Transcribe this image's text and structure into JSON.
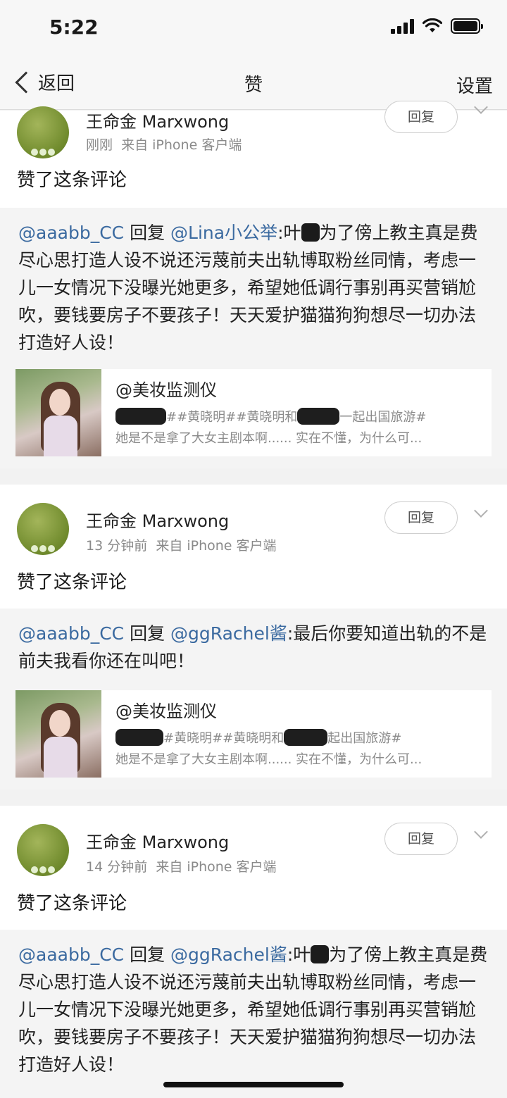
{
  "status_bar": {
    "time": "5:22"
  },
  "nav": {
    "back_label": "返回",
    "title": "赞",
    "settings_label": "设置"
  },
  "notifications": [
    {
      "username": "王命金 Marxwong",
      "time": "刚刚",
      "source": "来自 iPhone 客户端",
      "reply_label": "回复",
      "action": "赞了这条评论",
      "quote": {
        "author": "@aaabb_CC",
        "reply_word": "回复",
        "target": "@Lina小公举",
        "prefix": ":叶",
        "text": "为了傍上教主真是费尽心思打造人设不说还污蔑前夫出轨博取粉丝同情，考虑一儿一女情况下没曝光她更多，希望她低调行事别再买营销尬吹，要钱要房子不要孩子！天天爱护猫猫狗狗想尽一切办法打造好人设！"
      },
      "share": {
        "author": "@美妆监测仪",
        "tags_a": "##黄晓明##黄晓明和",
        "tags_b": "一起出国旅游#",
        "snippet": "她是不是拿了大女主剧本啊...... 实在不懂，为什么可..."
      }
    },
    {
      "username": "王命金 Marxwong",
      "time": "13 分钟前",
      "source": "来自 iPhone 客户端",
      "reply_label": "回复",
      "action": "赞了这条评论",
      "quote": {
        "author": "@aaabb_CC",
        "reply_word": "回复",
        "target": "@ggRachel酱",
        "prefix": "",
        "text": ":最后你要知道出轨的不是前夫我看你还在叫吧！"
      },
      "share": {
        "author": "@美妆监测仪",
        "tags_a": "#黄晓明##黄晓明和",
        "tags_b": "起出国旅游#",
        "snippet": "她是不是拿了大女主剧本啊...... 实在不懂，为什么可..."
      }
    },
    {
      "username": "王命金 Marxwong",
      "time": "14 分钟前",
      "source": "来自 iPhone 客户端",
      "reply_label": "回复",
      "action": "赞了这条评论",
      "quote": {
        "author": "@aaabb_CC",
        "reply_word": "回复",
        "target": "@ggRachel酱",
        "prefix": ":叶",
        "text": "为了傍上教主真是费尽心思打造人设不说还污蔑前夫出轨博取粉丝同情，考虑一儿一女情况下没曝光她更多，希望她低调行事别再买营销尬吹，要钱要房子不要孩子！天天爱护猫猫狗狗想尽一切办法打造好人设！"
      }
    }
  ]
}
